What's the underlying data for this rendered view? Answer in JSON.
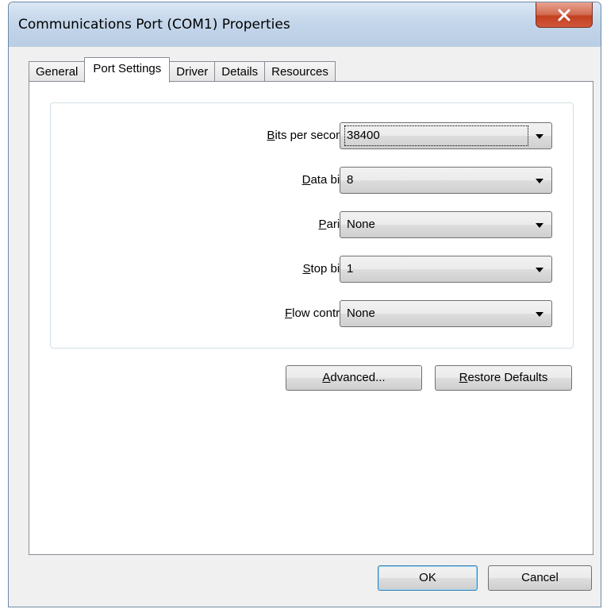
{
  "window": {
    "title": "Communications Port (COM1) Properties",
    "close_label": "X"
  },
  "tabs": [
    {
      "label": "General",
      "active": false
    },
    {
      "label": "Port Settings",
      "active": true
    },
    {
      "label": "Driver",
      "active": false
    },
    {
      "label": "Details",
      "active": false
    },
    {
      "label": "Resources",
      "active": false
    }
  ],
  "settings": {
    "bits_per_second": {
      "label_mnemonic": "B",
      "label_rest": "its per second:",
      "value": "38400"
    },
    "data_bits": {
      "label_mnemonic": "D",
      "label_rest": "ata bits:",
      "value": "8"
    },
    "parity": {
      "label_mnemonic": "P",
      "label_rest": "arity:",
      "value": "None"
    },
    "stop_bits": {
      "label_mnemonic": "S",
      "label_rest": "top bits:",
      "value": "1"
    },
    "flow_control": {
      "label_mnemonic": "F",
      "label_rest": "low control:",
      "value": "None"
    }
  },
  "buttons": {
    "advanced": {
      "mnemonic": "A",
      "rest": "dvanced..."
    },
    "restore_defaults": {
      "mnemonic": "R",
      "rest": "estore Defaults"
    },
    "ok": "OK",
    "cancel": "Cancel"
  },
  "colors": {
    "close_button": "#c94a2c",
    "titlebar": "#c4d6ea",
    "default_button_border": "#3c7fb1"
  }
}
